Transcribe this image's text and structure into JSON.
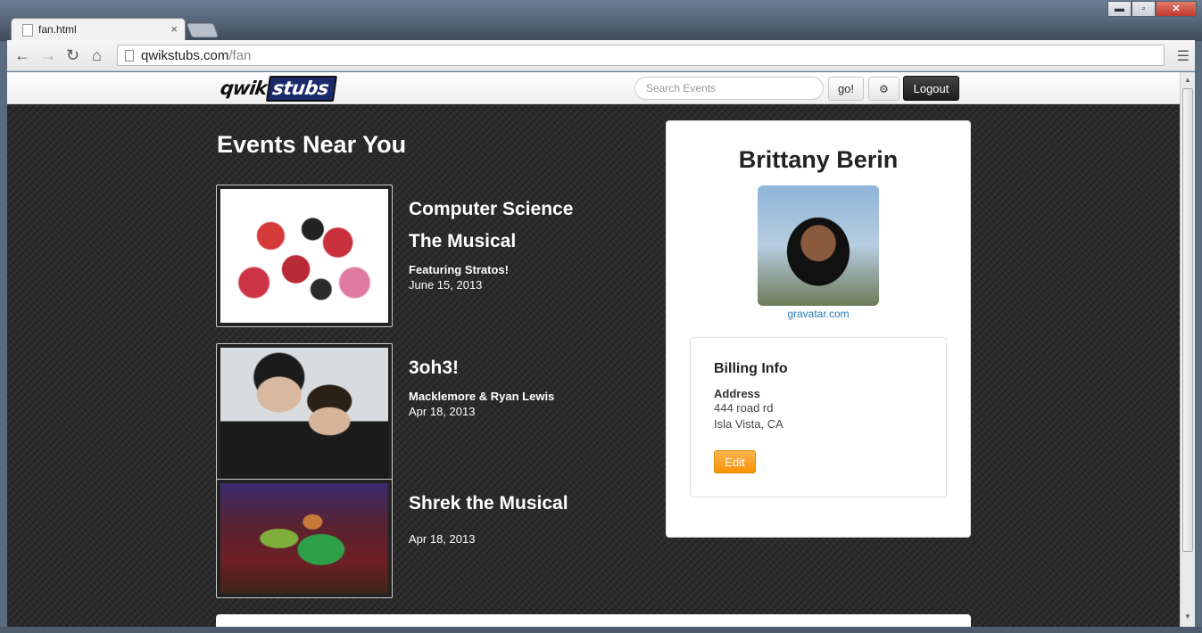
{
  "browser": {
    "tab_title": "fan.html",
    "tab_close": "×",
    "url_host": "qwikstubs.com",
    "url_path": "/fan",
    "window_controls": {
      "minimize": "▬",
      "maximize": "▫",
      "close": "✕"
    }
  },
  "navbar": {
    "logo_left": "qwik",
    "logo_right": "stubs",
    "search_placeholder": "Search Events",
    "go_label": "go!",
    "settings_icon": "gear-icon",
    "logout_label": "Logout"
  },
  "events": {
    "heading": "Events Near You",
    "items": [
      {
        "title_line1": "Computer Science",
        "title_line2": "The Musical",
        "featuring": "Featuring Stratos!",
        "date": "June 15, 2013"
      },
      {
        "title_line1": "3oh3!",
        "featuring": "Macklemore & Ryan Lewis",
        "date": "Apr 18, 2013"
      },
      {
        "title_line1": "Shrek the Musical",
        "featuring": "",
        "date": "Apr 18, 2013"
      }
    ]
  },
  "profile": {
    "name": "Brittany Berin",
    "gravatar_link": "gravatar.com",
    "billing": {
      "title": "Billing Info",
      "address_label": "Address",
      "address_line1": "444 road rd",
      "address_line2": "Isla Vista, CA",
      "edit_label": "Edit"
    }
  }
}
